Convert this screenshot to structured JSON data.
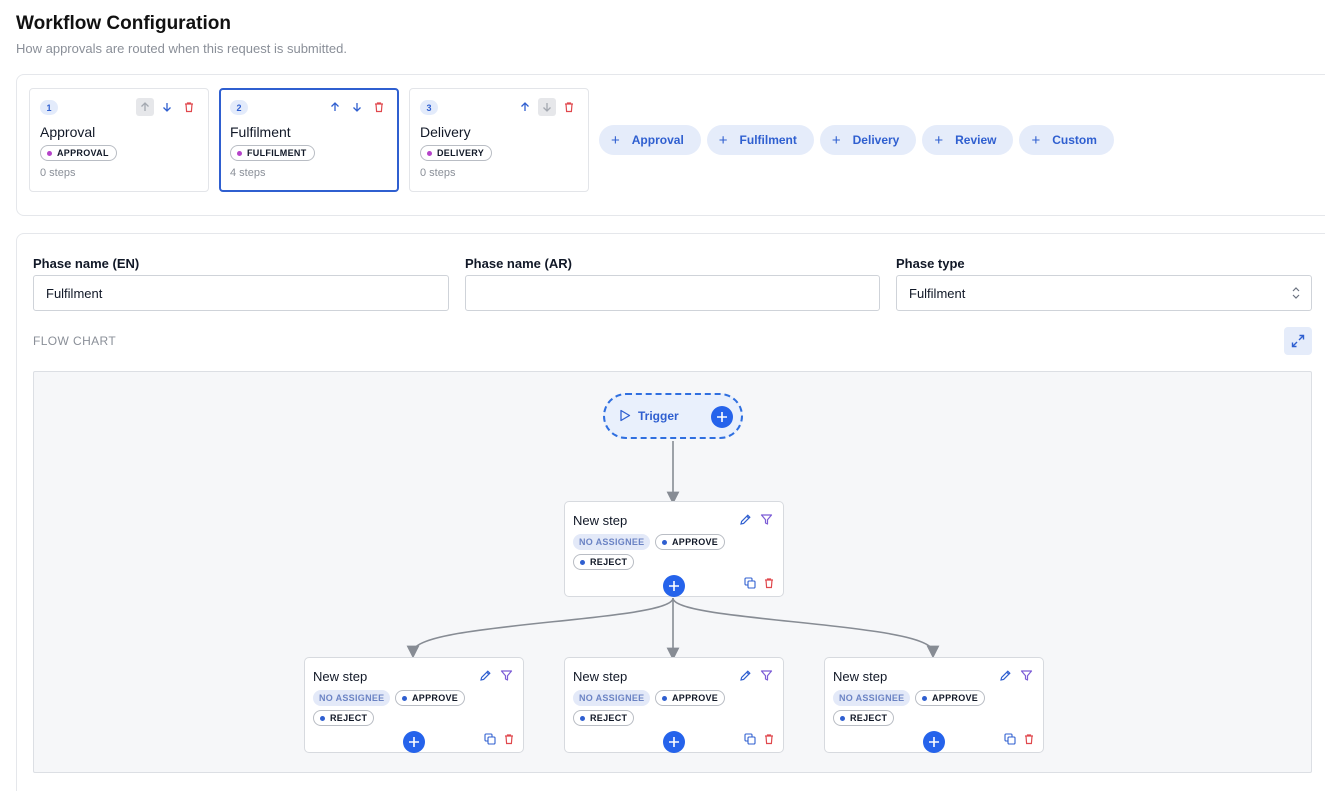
{
  "header": {
    "title": "Workflow Configuration",
    "subtitle": "How approvals are routed when this request is submitted."
  },
  "phases": [
    {
      "number": "1",
      "name": "Approval",
      "type": "APPROVAL",
      "steps": "0 steps",
      "selected": false
    },
    {
      "number": "2",
      "name": "Fulfilment",
      "type": "FULFILMENT",
      "steps": "4 steps",
      "selected": true
    },
    {
      "number": "3",
      "name": "Delivery",
      "type": "DELIVERY",
      "steps": "0 steps",
      "selected": false
    }
  ],
  "add_phase_buttons": [
    "Approval",
    "Fulfilment",
    "Delivery",
    "Review",
    "Custom"
  ],
  "form": {
    "name_en_label": "Phase name (EN)",
    "name_en_value": "Fulfilment",
    "name_ar_label": "Phase name (AR)",
    "name_ar_value": "",
    "type_label": "Phase type",
    "type_value": "Fulfilment"
  },
  "flow_chart": {
    "label": "FLOW CHART",
    "trigger_label": "Trigger",
    "steps": [
      {
        "title": "New step",
        "assignee": "NO ASSIGNEE",
        "actions": [
          "APPROVE",
          "REJECT"
        ]
      },
      {
        "title": "New step",
        "assignee": "NO ASSIGNEE",
        "actions": [
          "APPROVE",
          "REJECT"
        ]
      },
      {
        "title": "New step",
        "assignee": "NO ASSIGNEE",
        "actions": [
          "APPROVE",
          "REJECT"
        ]
      },
      {
        "title": "New step",
        "assignee": "NO ASSIGNEE",
        "actions": [
          "APPROVE",
          "REJECT"
        ]
      }
    ]
  },
  "colors": {
    "accent": "#2563eb",
    "selected_border": "#2f5fd0",
    "delete": "#e0484d",
    "filter": "#7c5cd6",
    "type_dot": "#b543c9"
  }
}
